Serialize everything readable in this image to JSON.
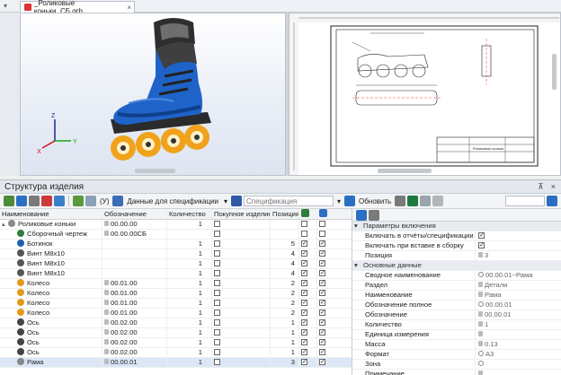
{
  "document_tab": {
    "title": "_Роликовые коньки_СБ.grb",
    "close": "×"
  },
  "panel": {
    "title": "Структура изделия",
    "pin": "⊼",
    "close": "×"
  },
  "toolbar": {
    "spec_data_label": "Данные для спецификации",
    "spec_placeholder": "Спецификация",
    "refresh_label": "Обновить",
    "f_label": "(У)"
  },
  "tree": {
    "columns": {
      "name": "Наименование",
      "designation": "Обозначение",
      "qty": "Количество",
      "purchased": "Покупное изделие",
      "position": "Позиция"
    },
    "rows": [
      {
        "name": "Роликовые коньки",
        "designation": "00.00.00",
        "qty": "1",
        "purchased": false,
        "position": "",
        "s1": false,
        "s2": false,
        "level": 0,
        "expand": "▴",
        "icon": "assembly-icon",
        "color": "#8a8a8a"
      },
      {
        "name": "Сборочный чертеж",
        "designation": "00.00.00СБ",
        "qty": "",
        "purchased": false,
        "position": "",
        "s1": false,
        "s2": false,
        "level": 1,
        "expand": "",
        "icon": "drawing-icon",
        "color": "#2f7d3a"
      },
      {
        "name": "Ботинок",
        "designation": "",
        "qty": "1",
        "purchased": false,
        "position": "5",
        "s1": true,
        "s2": true,
        "level": 1,
        "expand": "",
        "icon": "boot-icon",
        "color": "#1f5fb0"
      },
      {
        "name": "Винт М8х10",
        "designation": "",
        "qty": "1",
        "purchased": false,
        "position": "4",
        "s1": true,
        "s2": true,
        "level": 1,
        "expand": "",
        "icon": "screw-icon",
        "color": "#555"
      },
      {
        "name": "Винт М8х10",
        "designation": "",
        "qty": "1",
        "purchased": false,
        "position": "4",
        "s1": true,
        "s2": true,
        "level": 1,
        "expand": "",
        "icon": "screw-icon",
        "color": "#555"
      },
      {
        "name": "Винт М8х10",
        "designation": "",
        "qty": "1",
        "purchased": false,
        "position": "4",
        "s1": true,
        "s2": true,
        "level": 1,
        "expand": "",
        "icon": "screw-icon",
        "color": "#555"
      },
      {
        "name": "Колесо",
        "designation": "00.01.00",
        "qty": "1",
        "purchased": false,
        "position": "2",
        "s1": true,
        "s2": true,
        "level": 1,
        "expand": "",
        "icon": "wheel-icon",
        "color": "#e39a18"
      },
      {
        "name": "Колесо",
        "designation": "00.01.00",
        "qty": "1",
        "purchased": false,
        "position": "2",
        "s1": true,
        "s2": true,
        "level": 1,
        "expand": "",
        "icon": "wheel-icon",
        "color": "#e39a18"
      },
      {
        "name": "Колесо",
        "designation": "00.01.00",
        "qty": "1",
        "purchased": false,
        "position": "2",
        "s1": true,
        "s2": true,
        "level": 1,
        "expand": "",
        "icon": "wheel-icon",
        "color": "#e39a18"
      },
      {
        "name": "Колесо",
        "designation": "00.01.00",
        "qty": "1",
        "purchased": false,
        "position": "2",
        "s1": true,
        "s2": true,
        "level": 1,
        "expand": "",
        "icon": "wheel-icon",
        "color": "#e39a18"
      },
      {
        "name": "Ось",
        "designation": "00.02.00",
        "qty": "1",
        "purchased": false,
        "position": "1",
        "s1": true,
        "s2": true,
        "level": 1,
        "expand": "",
        "icon": "axle-icon",
        "color": "#444"
      },
      {
        "name": "Ось",
        "designation": "00.02.00",
        "qty": "1",
        "purchased": false,
        "position": "1",
        "s1": true,
        "s2": true,
        "level": 1,
        "expand": "",
        "icon": "axle-icon",
        "color": "#444"
      },
      {
        "name": "Ось",
        "designation": "00.02.00",
        "qty": "1",
        "purchased": false,
        "position": "1",
        "s1": true,
        "s2": true,
        "level": 1,
        "expand": "",
        "icon": "axle-icon",
        "color": "#444"
      },
      {
        "name": "Ось",
        "designation": "00.02.00",
        "qty": "1",
        "purchased": false,
        "position": "1",
        "s1": true,
        "s2": true,
        "level": 1,
        "expand": "",
        "icon": "axle-icon",
        "color": "#444"
      },
      {
        "name": "Рама",
        "designation": "00.00.01",
        "qty": "1",
        "purchased": false,
        "position": "3",
        "s1": true,
        "s2": true,
        "level": 1,
        "expand": "",
        "icon": "frame-icon",
        "color": "#888"
      }
    ]
  },
  "properties": {
    "groups": [
      {
        "title": "Параметры включения",
        "rows": [
          {
            "name": "Включать в отчёты/спецификации",
            "value": "",
            "check": true
          },
          {
            "name": "Включать при вставке в сборку",
            "value": "",
            "check": true
          },
          {
            "name": "Позиция",
            "value": "3"
          }
        ]
      },
      {
        "title": "Основные данные",
        "rows": [
          {
            "name": "Сводное наименование",
            "value": "00.00.01~Рама",
            "gear": true
          },
          {
            "name": "Раздел",
            "value": "Детали"
          },
          {
            "name": "Наименование",
            "value": "Рама"
          },
          {
            "name": "Обозначение полное",
            "value": "00.00.01",
            "gear": true
          },
          {
            "name": "Обозначение",
            "value": "00.00.01"
          },
          {
            "name": "Количество",
            "value": "1"
          },
          {
            "name": "Единица измерения",
            "value": ""
          },
          {
            "name": "Масса",
            "value": "0.13"
          },
          {
            "name": "Формат",
            "value": "А3",
            "gear": true
          },
          {
            "name": "Зона",
            "value": "",
            "gear": true
          },
          {
            "name": "Примечание",
            "value": ""
          }
        ]
      }
    ]
  },
  "drawing": {
    "title_block_name": "Роликовые коньки"
  },
  "axes": {
    "x": "X",
    "y": "Y",
    "z": "Z"
  }
}
